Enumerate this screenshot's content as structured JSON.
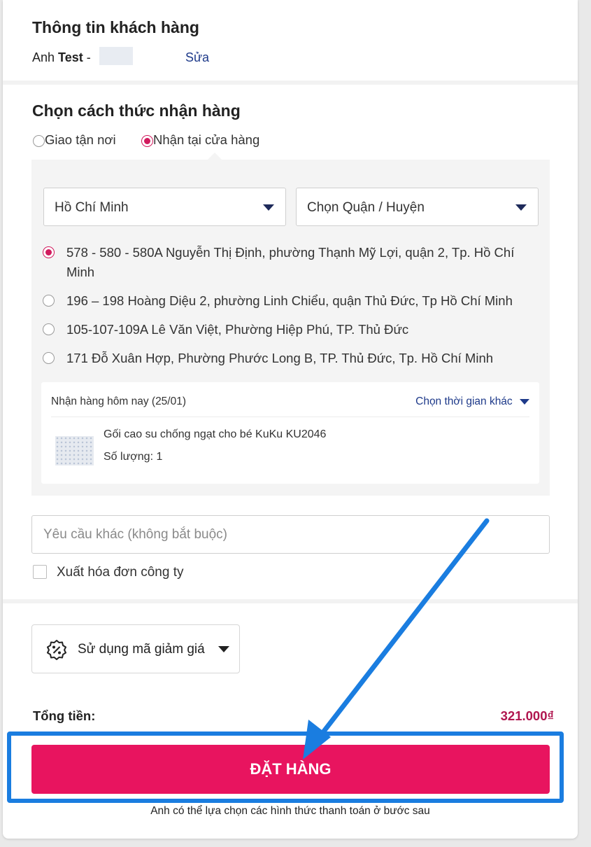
{
  "customer": {
    "title": "Thông tin khách hàng",
    "salutation": "Anh",
    "name": "Test",
    "dash": "-",
    "edit_label": "Sửa"
  },
  "delivery": {
    "title": "Chọn cách thức nhận hàng",
    "options": [
      {
        "label": "Giao tận nơi",
        "selected": false
      },
      {
        "label": "Nhận tại cửa hàng",
        "selected": true
      }
    ],
    "city_select": "Hồ Chí Minh",
    "district_select": "Chọn Quận / Huyện",
    "stores": [
      {
        "address": "578 - 580 - 580A Nguyễn Thị Định, phường Thạnh Mỹ Lợi, quận 2, Tp. Hồ Chí Minh",
        "selected": true
      },
      {
        "address": "196 – 198 Hoàng Diệu 2, phường Linh Chiểu, quận Thủ Đức, Tp Hồ Chí Minh",
        "selected": false
      },
      {
        "address": "105-107-109A Lê Văn Việt, Phường Hiệp Phú, TP. Thủ Đức",
        "selected": false
      },
      {
        "address": "171 Đỗ Xuân Hợp, Phường Phước Long B, TP. Thủ Đức, Tp. Hồ Chí Minh",
        "selected": false
      }
    ],
    "pickup": {
      "date_label": "Nhận hàng hôm nay (25/01)",
      "other_time_label": "Chọn thời gian khác",
      "product_name": "Gối cao su chống ngạt cho bé KuKu KU2046",
      "quantity_label": "Số lượng: 1"
    }
  },
  "extra_request_placeholder": "Yêu cầu khác (không bắt buộc)",
  "invoice_label": "Xuất hóa đơn công ty",
  "coupon_label": "Sử dụng mã giảm giá",
  "total": {
    "label": "Tổng tiền:",
    "amount": "321.000₫"
  },
  "order_button_label": "ĐẶT HÀNG",
  "payment_note": "Anh có thể lựa chọn các hình thức thanh toán ở bước sau",
  "colors": {
    "accent": "#e8145f",
    "price": "#b0164f",
    "link": "#1e3a8a",
    "annotation": "#1a7de0"
  }
}
